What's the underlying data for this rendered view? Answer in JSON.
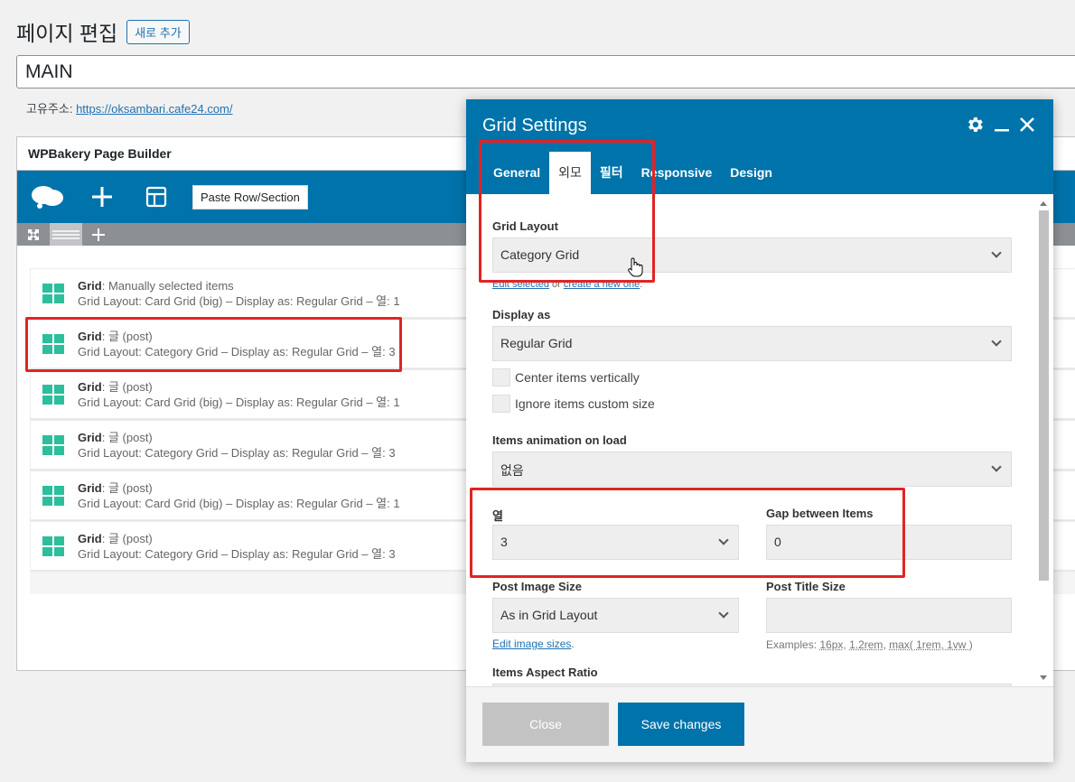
{
  "page": {
    "title": "페이지 편집",
    "add_new_label": "새로 추가",
    "post_title": "MAIN",
    "permalink_label": "고유주소:",
    "permalink_url": "https://oksambari.cafe24.com/"
  },
  "builder": {
    "title": "WPBakery Page Builder",
    "paste_label": "Paste Row/Section",
    "rows": [
      {
        "name": "Grid",
        "type": ": Manually selected items",
        "desc": "Grid Layout: Card Grid (big) – Display as: Regular Grid – 열: 1"
      },
      {
        "name": "Grid",
        "type": ": 글 (post)",
        "desc": "Grid Layout: Category Grid – Display as: Regular Grid – 열: 3"
      },
      {
        "name": "Grid",
        "type": ": 글 (post)",
        "desc": "Grid Layout: Card Grid (big) – Display as: Regular Grid – 열: 1"
      },
      {
        "name": "Grid",
        "type": ": 글 (post)",
        "desc": "Grid Layout: Category Grid – Display as: Regular Grid – 열: 3"
      },
      {
        "name": "Grid",
        "type": ": 글 (post)",
        "desc": "Grid Layout: Card Grid (big) – Display as: Regular Grid – 열: 1"
      },
      {
        "name": "Grid",
        "type": ": 글 (post)",
        "desc": "Grid Layout: Category Grid – Display as: Regular Grid – 열: 3"
      }
    ]
  },
  "modal": {
    "title": "Grid Settings",
    "tabs": [
      "General",
      "외모",
      "필터",
      "Responsive",
      "Design"
    ],
    "active_tab": "외모",
    "grid_layout_label": "Grid Layout",
    "grid_layout_value": "Category Grid",
    "edit_selected": "Edit selected",
    "or_text": "or",
    "create_new": "create a new one",
    "period": ".",
    "display_as_label": "Display as",
    "display_as_value": "Regular Grid",
    "center_items_label": "Center items vertically",
    "ignore_size_label": "Ignore items custom size",
    "animation_label": "Items animation on load",
    "animation_value": "없음",
    "columns_label": "열",
    "columns_value": "3",
    "gap_label": "Gap between Items",
    "gap_value": "0",
    "post_image_size_label": "Post Image Size",
    "post_image_size_value": "As in Grid Layout",
    "edit_image_sizes": "Edit image sizes",
    "post_title_size_label": "Post Title Size",
    "post_title_size_value": "",
    "examples_prefix": "Examples:",
    "examples": [
      "16px",
      "1.2rem",
      "max( 1rem, 1vw )"
    ],
    "aspect_ratio_label": "Items Aspect Ratio",
    "close_label": "Close",
    "save_label": "Save changes"
  },
  "colors": {
    "wp_blue": "#0073aa",
    "grid_icon": "#2bbf9c",
    "highlight_red": "#e02424"
  }
}
